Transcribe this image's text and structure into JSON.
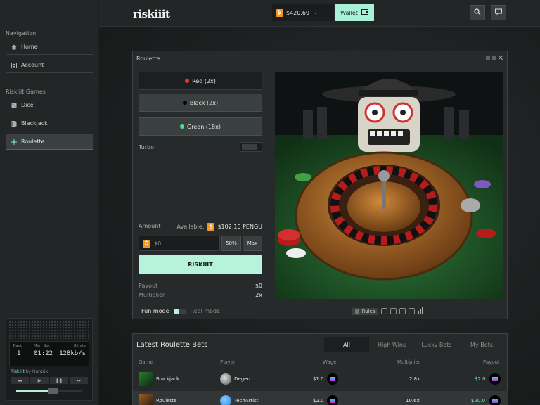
{
  "app": {
    "logo": "riskiiit"
  },
  "topbar": {
    "balance": "$420.69",
    "wallet_label": "Wallet",
    "currency_symbol": "₿"
  },
  "sidebar": {
    "nav_title": "Navigation",
    "nav_items": [
      {
        "label": "Home",
        "icon": "home-icon"
      },
      {
        "label": "Account",
        "icon": "account-icon"
      }
    ],
    "games_title": "Riskiiit Games",
    "game_items": [
      {
        "label": "Dice",
        "icon": "dice-icon"
      },
      {
        "label": "Blackjack",
        "icon": "cards-icon"
      },
      {
        "label": "Roulette",
        "icon": "roulette-icon",
        "active": true
      }
    ]
  },
  "player": {
    "track_label": "Track",
    "min_label": "Min",
    "sec_label": "Sec",
    "bitrate_label": "Bitrate",
    "track": "1",
    "time": "01:22",
    "bitrate": "128kb/s",
    "credit_app": "Riskiiit",
    "credit_by": "by Huntrix",
    "volume": 0.55
  },
  "roulette": {
    "title": "Roulette",
    "bets": [
      {
        "label": "Red (2x)",
        "color": "#e53935"
      },
      {
        "label": "Black (2x)",
        "color": "#000000"
      },
      {
        "label": "Green (18x)",
        "color": "#4ce08f"
      }
    ],
    "turbo_label": "Turbo",
    "amount_label": "Amount",
    "available_label": "Available:",
    "available_value": "$102,10 PENGU",
    "amount_value": "$0",
    "half_label": "50%",
    "max_label": "Max",
    "action_label": "RISKIIIT",
    "payout_label": "Payout",
    "payout_value": "$0",
    "multiplier_label": "Multiplier",
    "multiplier_value": "2x",
    "fun_mode_label": "Fun mode",
    "real_mode_label": "Real mode",
    "rules_label": "Rules"
  },
  "bets_panel": {
    "title": "Latest Roulette Bets",
    "tabs": [
      "All",
      "High Wins",
      "Lucky Bets",
      "My Bets"
    ],
    "columns": [
      "Game",
      "Player",
      "Wager",
      "Multiplier",
      "Payout"
    ],
    "rows": [
      {
        "game": "Blackjack",
        "player": "Degen",
        "wager": "$1.0",
        "multiplier": "2.8x",
        "payout": "$2.0"
      },
      {
        "game": "Roulette",
        "player": "TechArtist",
        "wager": "$2.0",
        "multiplier": "10.6x",
        "payout": "$20.0"
      }
    ]
  },
  "colors": {
    "accent": "#b6f2dc",
    "payout": "#72e7c2",
    "bitcoin": "#f7931a"
  }
}
